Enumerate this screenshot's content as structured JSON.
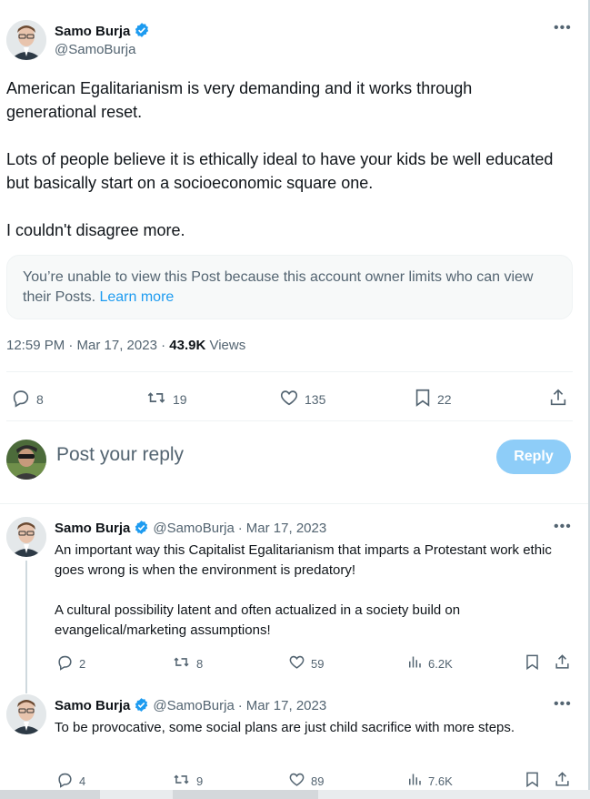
{
  "main_post": {
    "author_name": "Samo Burja",
    "author_handle": "@SamoBurja",
    "paragraphs": [
      "American Egalitarianism is very demanding and it works through generational reset.",
      "Lots of people believe it is ethically ideal to have your kids be well educated but basically start on a socioeconomic square one.",
      "I couldn't disagree more."
    ],
    "notice_text": "You’re unable to view this Post because this account owner limits who can view their Posts.",
    "notice_link": "Learn more",
    "timestamp": "12:59 PM · Mar 17, 2023 · ",
    "views_count": "43.9K",
    "views_label": "Views",
    "stats": {
      "replies": "8",
      "reposts": "19",
      "likes": "135",
      "bookmarks": "22"
    }
  },
  "composer": {
    "placeholder": "Post your reply",
    "reply_label": "Reply"
  },
  "replies": [
    {
      "author_name": "Samo Burja",
      "author_handle": "@SamoBurja",
      "date": "Mar 17, 2023",
      "paragraphs": [
        "An important way this Capitalist Egalitarianism that imparts a Protestant work ethic goes wrong is when the environment is predatory!",
        "A cultural possibility latent and often actualized in a society build on evangelical/marketing assumptions!"
      ],
      "stats": {
        "replies": "2",
        "reposts": "8",
        "likes": "59",
        "views": "6.2K"
      }
    },
    {
      "author_name": "Samo Burja",
      "author_handle": "@SamoBurja",
      "date": "Mar 17, 2023",
      "paragraphs": [
        "To be provocative, some social plans are just child sacrifice with more steps."
      ],
      "stats": {
        "replies": "4",
        "reposts": "9",
        "likes": "89",
        "views": "7.6K"
      }
    }
  ],
  "colors": {
    "accent": "#1d9bf0",
    "reply_button_disabled": "#8ecdf8",
    "text_primary": "#0f1419",
    "text_secondary": "#536471"
  },
  "icons": [
    "verified-badge-icon",
    "more-icon",
    "reply-icon",
    "repost-icon",
    "like-icon",
    "bookmark-icon",
    "share-icon",
    "views-icon"
  ]
}
